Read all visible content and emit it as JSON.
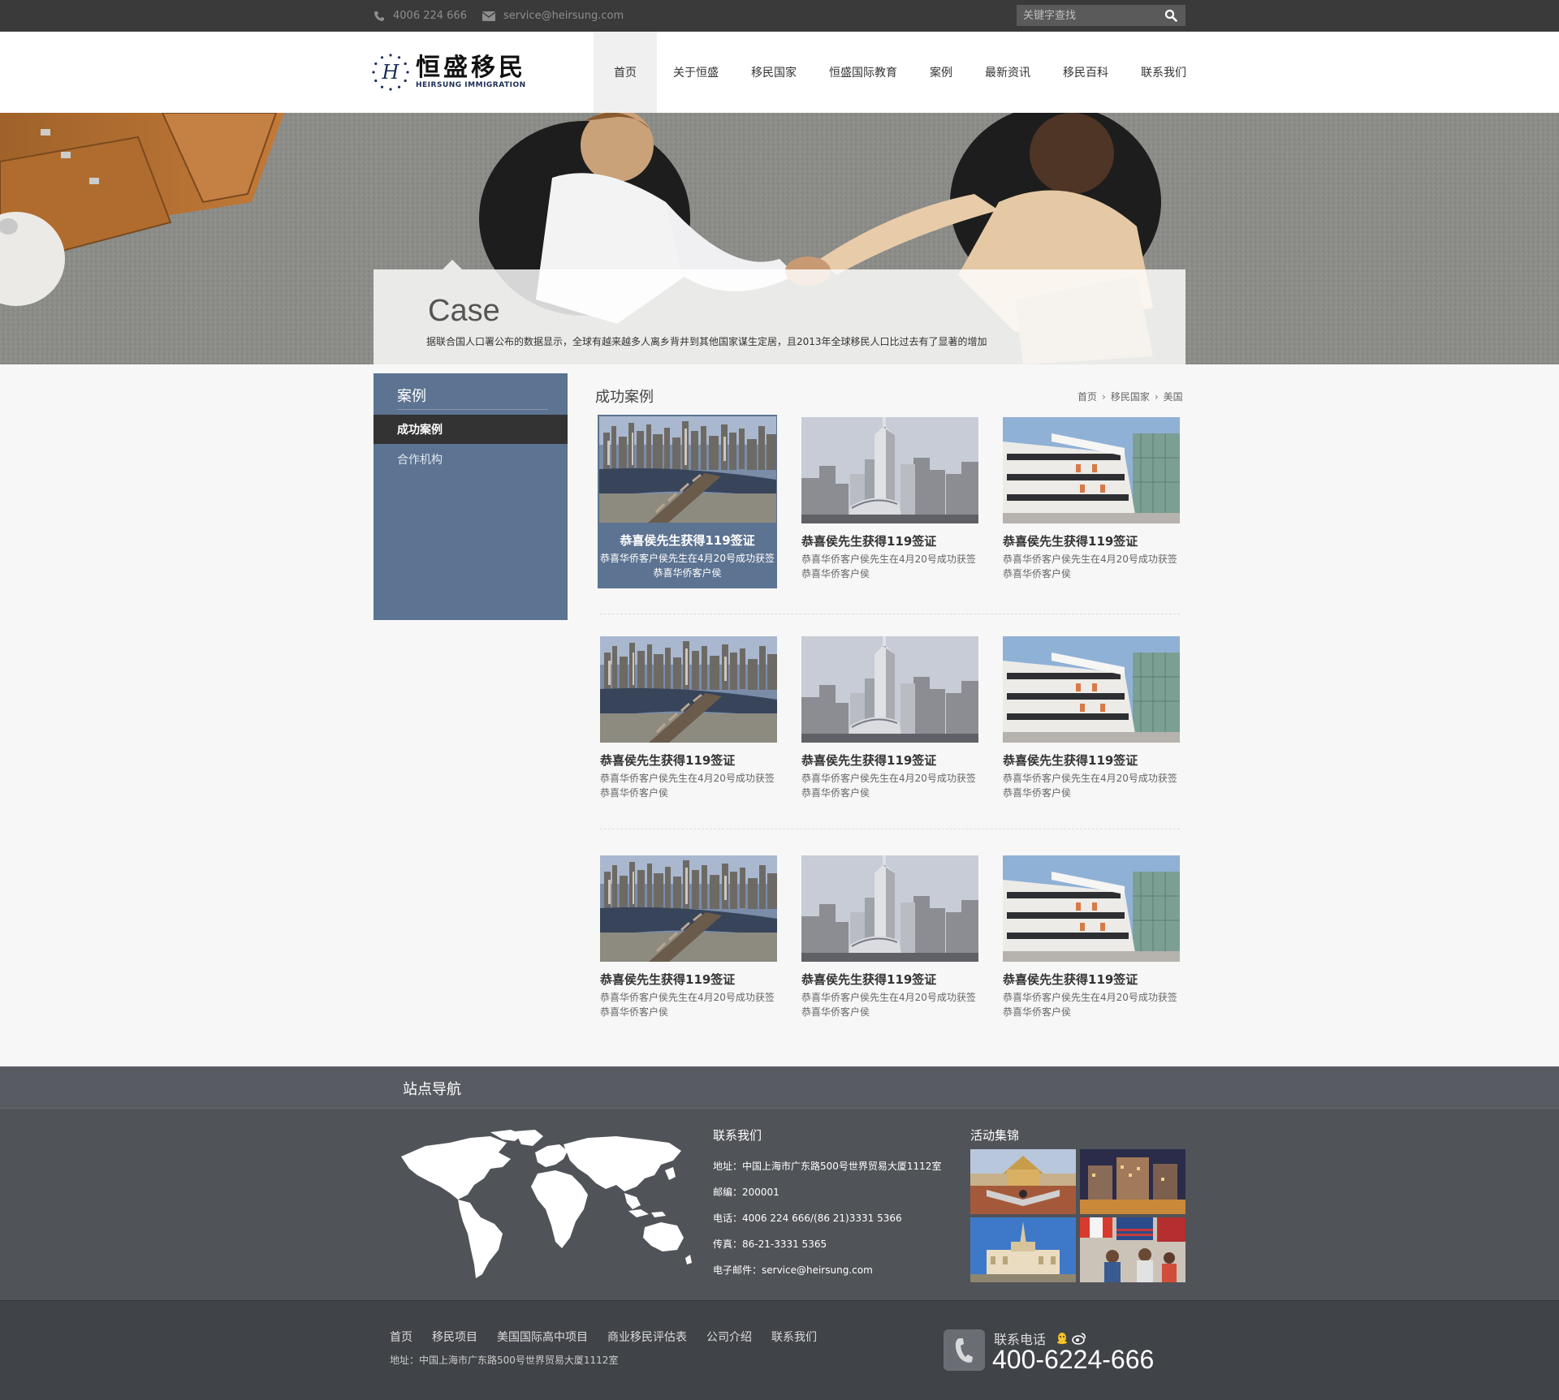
{
  "topbar": {
    "phone": "4006 224 666",
    "email": "service@heirsung.com",
    "search_placeholder": "关键字查找"
  },
  "logo": {
    "cn": "恒盛移民",
    "en": "HEIRSUNG IMMIGRATION",
    "mark": "H"
  },
  "nav": [
    {
      "label": "首页"
    },
    {
      "label": "关于恒盛"
    },
    {
      "label": "移民国家"
    },
    {
      "label": "恒盛国际教育"
    },
    {
      "label": "案例"
    },
    {
      "label": "最新资讯"
    },
    {
      "label": "移民百科"
    },
    {
      "label": "联系我们"
    }
  ],
  "banner": {
    "title": "Case",
    "description": "据联合国人口署公布的数据显示，全球有越来越多人离乡背井到其他国家谋生定居，且2013年全球移民人口比过去有了显著的增加"
  },
  "sidebar": {
    "title": "案例",
    "items": [
      {
        "label": "成功案例",
        "active": true
      },
      {
        "label": "合作机构",
        "active": false
      }
    ]
  },
  "main": {
    "title": "成功案例",
    "breadcrumb": [
      "首页",
      "移民国家",
      "美国"
    ],
    "cards": [
      {
        "image": "city-river-bridge",
        "title": "恭喜侯先生获得119签证",
        "desc_line1": "恭喜华侨客户侯先生在4月20号成功获签",
        "desc_line2": "恭喜华侨客户侯"
      },
      {
        "image": "city-skyline-tower",
        "title": "恭喜侯先生获得119签证",
        "desc_line1": "恭喜华侨客户侯先生在4月20号成功获签",
        "desc_line2": "恭喜华侨客户侯"
      },
      {
        "image": "modern-building",
        "title": "恭喜侯先生获得119签证",
        "desc_line1": "恭喜华侨客户侯先生在4月20号成功获签",
        "desc_line2": "恭喜华侨客户侯"
      },
      {
        "image": "city-river-bridge",
        "title": "恭喜侯先生获得119签证",
        "desc_line1": "恭喜华侨客户侯先生在4月20号成功获签",
        "desc_line2": "恭喜华侨客户侯"
      },
      {
        "image": "city-skyline-tower",
        "title": "恭喜侯先生获得119签证",
        "desc_line1": "恭喜华侨客户侯先生在4月20号成功获签",
        "desc_line2": "恭喜华侨客户侯"
      },
      {
        "image": "modern-building",
        "title": "恭喜侯先生获得119签证",
        "desc_line1": "恭喜华侨客户侯先生在4月20号成功获签",
        "desc_line2": "恭喜华侨客户侯"
      },
      {
        "image": "city-river-bridge",
        "title": "恭喜侯先生获得119签证",
        "desc_line1": "恭喜华侨客户侯先生在4月20号成功获签",
        "desc_line2": "恭喜华侨客户侯"
      },
      {
        "image": "city-skyline-tower",
        "title": "恭喜侯先生获得119签证",
        "desc_line1": "恭喜华侨客户侯先生在4月20号成功获签",
        "desc_line2": "恭喜华侨客户侯"
      },
      {
        "image": "modern-building",
        "title": "恭喜侯先生获得119签证",
        "desc_line1": "恭喜华侨客户侯先生在4月20号成功获签",
        "desc_line2": "恭喜华侨客户侯"
      }
    ]
  },
  "footer": {
    "site_nav_title": "站点导航",
    "contact": {
      "title": "联系我们",
      "address": "地址：中国上海市广东路500号世界贸易大厦1112室",
      "postcode": "邮编：200001",
      "phone": "电话：4006 224 666/(86 21)3331 5366",
      "fax": "传真：86-21-3331 5365",
      "email": "电子邮件：service@heirsung.com"
    },
    "gallery_title": "活动集锦",
    "bottom_nav": [
      {
        "label": "首页"
      },
      {
        "label": "移民项目"
      },
      {
        "label": "美国国际高中项目"
      },
      {
        "label": "商业移民评估表"
      },
      {
        "label": "公司介绍"
      },
      {
        "label": "联系我们"
      }
    ],
    "bottom_address": "地址：中国上海市广东路500号世界贸易大厦1112室",
    "hotline_label": "联系电话",
    "hotline_number": "400-6224-666"
  },
  "colors": {
    "topbar_bg": "#3a3a3a",
    "sidebar_bg": "#5c7391",
    "footer_bg": "#505358",
    "footer_bottom_bg": "#404348"
  }
}
